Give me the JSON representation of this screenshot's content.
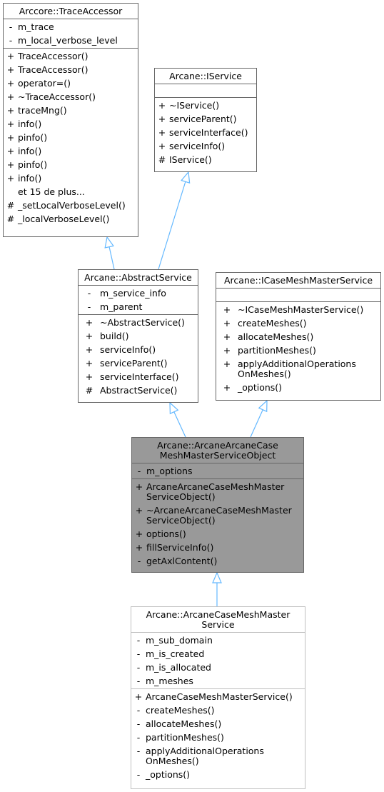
{
  "diagram": {
    "colors": {
      "edge": "#63b8ff",
      "box_border": "#666666",
      "highlight_fill": "#999999",
      "external_border": "#bfbfbf"
    },
    "classes": {
      "trace_accessor": {
        "title": "Arccore::TraceAccessor",
        "attributes": [
          {
            "vis": "-",
            "name": "m_trace"
          },
          {
            "vis": "-",
            "name": "m_local_verbose_level"
          }
        ],
        "methods": [
          {
            "vis": "+",
            "name": "TraceAccessor()"
          },
          {
            "vis": "+",
            "name": "TraceAccessor()"
          },
          {
            "vis": "+",
            "name": "operator=()"
          },
          {
            "vis": "+",
            "name": "~TraceAccessor()"
          },
          {
            "vis": "+",
            "name": "traceMng()"
          },
          {
            "vis": "+",
            "name": "info()"
          },
          {
            "vis": "+",
            "name": "pinfo()"
          },
          {
            "vis": "+",
            "name": "info()"
          },
          {
            "vis": "+",
            "name": "pinfo()"
          },
          {
            "vis": "+",
            "name": "info()"
          },
          {
            "vis": "",
            "name": "et 15 de plus..."
          },
          {
            "vis": "#",
            "name": "_setLocalVerboseLevel()"
          },
          {
            "vis": "#",
            "name": "_localVerboseLevel()"
          }
        ]
      },
      "iservice": {
        "title": "Arcane::IService",
        "attributes": [],
        "methods": [
          {
            "vis": "+",
            "name": "~IService()"
          },
          {
            "vis": "+",
            "name": "serviceParent()"
          },
          {
            "vis": "+",
            "name": "serviceInterface()"
          },
          {
            "vis": "+",
            "name": "serviceInfo()"
          },
          {
            "vis": "#",
            "name": "IService()"
          }
        ]
      },
      "abstract_service": {
        "title": "Arcane::AbstractService",
        "attributes": [
          {
            "vis": "-",
            "name": "m_service_info"
          },
          {
            "vis": "-",
            "name": "m_parent"
          }
        ],
        "methods": [
          {
            "vis": "+",
            "name": "~AbstractService()"
          },
          {
            "vis": "+",
            "name": "build()"
          },
          {
            "vis": "+",
            "name": "serviceInfo()"
          },
          {
            "vis": "+",
            "name": "serviceParent()"
          },
          {
            "vis": "+",
            "name": "serviceInterface()"
          },
          {
            "vis": "#",
            "name": "AbstractService()"
          }
        ]
      },
      "icase_mesh_master_service": {
        "title": "Arcane::ICaseMeshMasterService",
        "attributes": [],
        "methods": [
          {
            "vis": "+",
            "name": "~ICaseMeshMasterService()"
          },
          {
            "vis": "+",
            "name": "createMeshes()"
          },
          {
            "vis": "+",
            "name": "allocateMeshes()"
          },
          {
            "vis": "+",
            "name": "partitionMeshes()"
          },
          {
            "vis": "+",
            "name": "applyAdditionalOperations\nOnMeshes()"
          },
          {
            "vis": "+",
            "name": "_options()"
          }
        ]
      },
      "service_object": {
        "title": "Arcane::ArcaneArcaneCase\nMeshMasterServiceObject",
        "attributes": [
          {
            "vis": "-",
            "name": "m_options"
          }
        ],
        "methods": [
          {
            "vis": "+",
            "name": "ArcaneArcaneCaseMeshMaster\nServiceObject()"
          },
          {
            "vis": "+",
            "name": "~ArcaneArcaneCaseMeshMaster\nServiceObject()"
          },
          {
            "vis": "+",
            "name": "options()"
          },
          {
            "vis": "+",
            "name": "fillServiceInfo()"
          },
          {
            "vis": "-",
            "name": "getAxlContent()"
          }
        ]
      },
      "mesh_master_service": {
        "title": "Arcane::ArcaneCaseMeshMaster\nService",
        "attributes": [
          {
            "vis": "-",
            "name": "m_sub_domain"
          },
          {
            "vis": "-",
            "name": "m_is_created"
          },
          {
            "vis": "-",
            "name": "m_is_allocated"
          },
          {
            "vis": "-",
            "name": "m_meshes"
          }
        ],
        "methods": [
          {
            "vis": "+",
            "name": "ArcaneCaseMeshMasterService()"
          },
          {
            "vis": "-",
            "name": "createMeshes()"
          },
          {
            "vis": "-",
            "name": "allocateMeshes()"
          },
          {
            "vis": "-",
            "name": "partitionMeshes()"
          },
          {
            "vis": "-",
            "name": "applyAdditionalOperations\nOnMeshes()"
          },
          {
            "vis": "-",
            "name": "_options()"
          }
        ]
      }
    },
    "edges": [
      {
        "from": "abstract_service",
        "to": "trace_accessor",
        "type": "inheritance"
      },
      {
        "from": "abstract_service",
        "to": "iservice",
        "type": "inheritance"
      },
      {
        "from": "service_object",
        "to": "abstract_service",
        "type": "inheritance"
      },
      {
        "from": "service_object",
        "to": "icase_mesh_master_service",
        "type": "inheritance"
      },
      {
        "from": "mesh_master_service",
        "to": "service_object",
        "type": "inheritance"
      }
    ]
  }
}
